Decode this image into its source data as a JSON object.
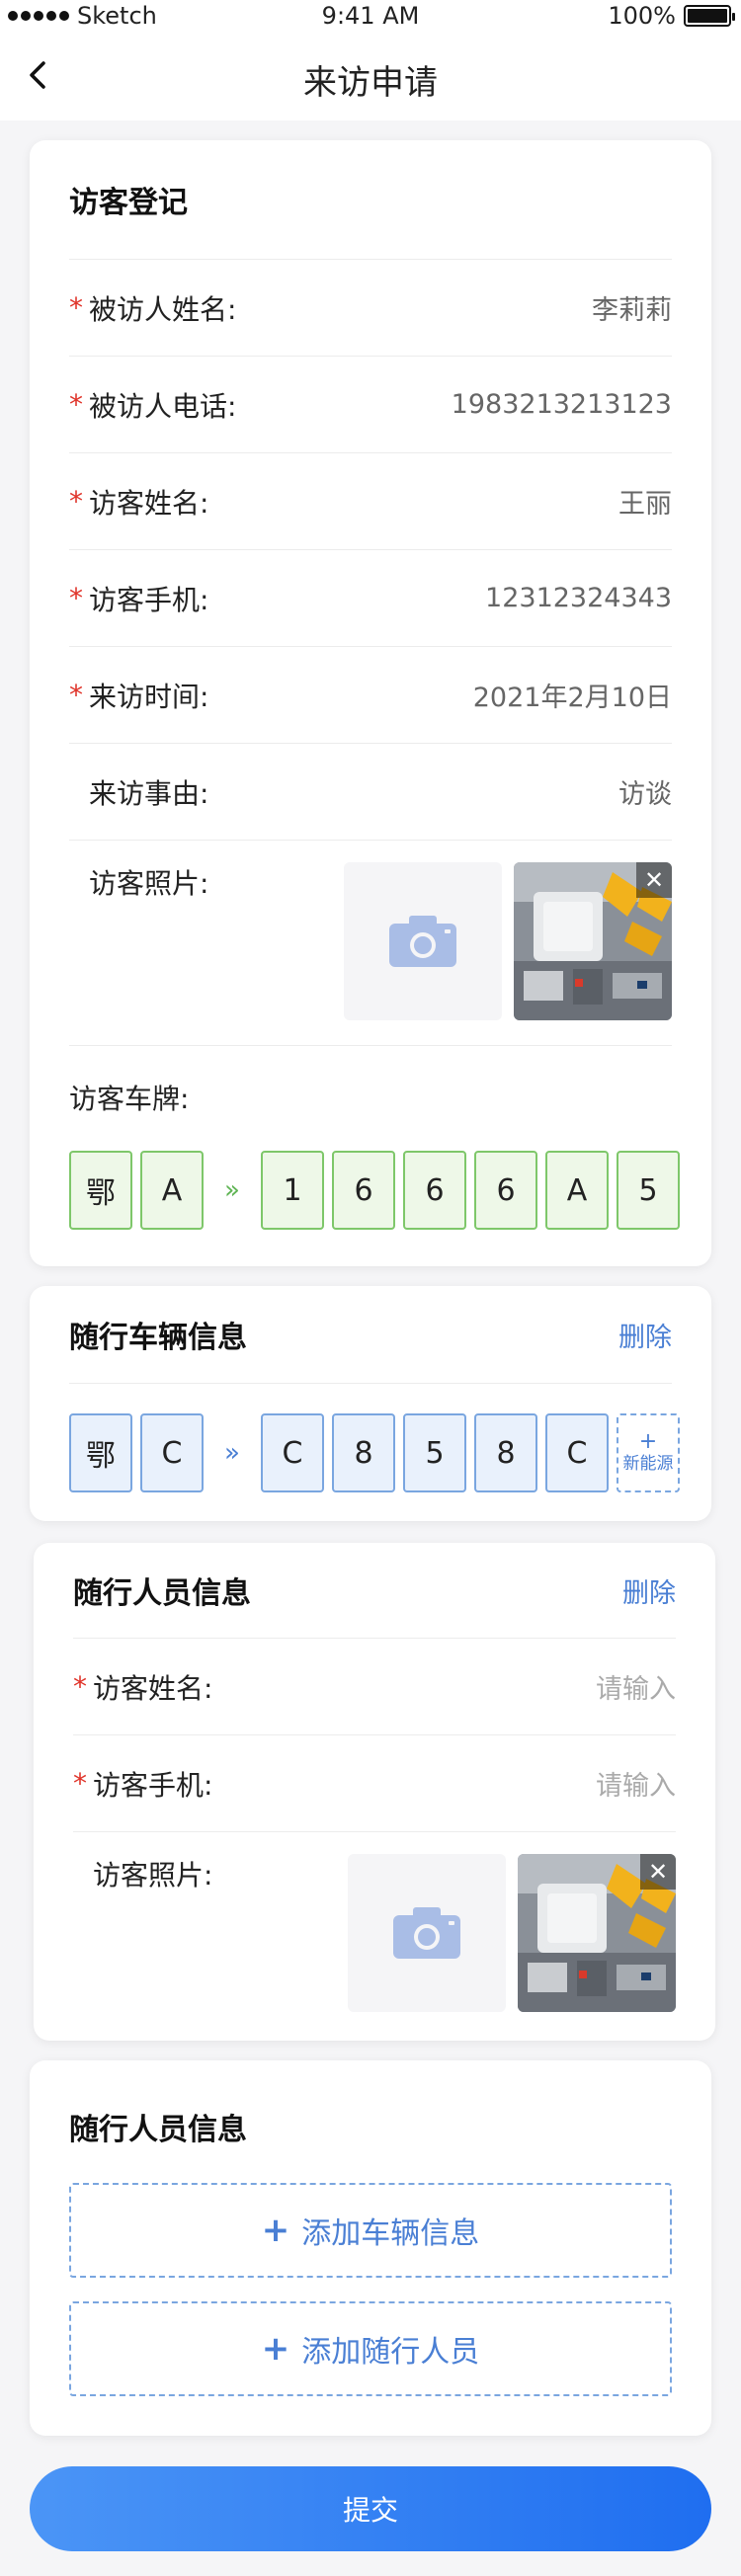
{
  "status_bar": {
    "carrier": "Sketch",
    "time": "9:41 AM",
    "battery": "100%"
  },
  "nav": {
    "title": "来访申请",
    "back_icon": "chevron-left-icon"
  },
  "visitor_card": {
    "title": "访客登记",
    "fields": [
      {
        "label": "被访人姓名:",
        "value": "李莉莉",
        "required": true
      },
      {
        "label": "被访人电话:",
        "value": "1983213213123",
        "required": true
      },
      {
        "label": "访客姓名:",
        "value": "王丽",
        "required": true
      },
      {
        "label": "访客手机:",
        "value": "12312324343",
        "required": true
      },
      {
        "label": "来访时间:",
        "value": "2021年2月10日",
        "required": true
      },
      {
        "label": "来访事由:",
        "value": "访谈",
        "required": false
      }
    ],
    "photo_label": "访客照片:",
    "plate_label": "访客车牌:",
    "plate": {
      "province": "鄂",
      "letter": "A",
      "separator": "»",
      "chars": [
        "1",
        "6",
        "6",
        "6",
        "A",
        "5"
      ]
    }
  },
  "vehicle_card": {
    "title": "随行车辆信息",
    "delete_label": "删除",
    "plate": {
      "province": "鄂",
      "letter": "C",
      "separator": "»",
      "chars": [
        "C",
        "8",
        "5",
        "8",
        "C"
      ]
    },
    "new_energy": {
      "plus": "+",
      "label": "新能源"
    }
  },
  "companion_card": {
    "title": "随行人员信息",
    "delete_label": "删除",
    "fields": [
      {
        "label": "访客姓名:",
        "placeholder": "请输入",
        "required": true
      },
      {
        "label": "访客手机:",
        "placeholder": "请输入",
        "required": true
      }
    ],
    "photo_label": "访客照片:"
  },
  "add_card": {
    "title": "随行人员信息",
    "add_vehicle": "添加车辆信息",
    "add_person": "添加随行人员",
    "plus": "+"
  },
  "required_mark": "*",
  "close_mark": "✕",
  "submit_label": "提交",
  "colors": {
    "primary": "#1f6ef0",
    "link": "#4a7fd4",
    "required": "#e0342a",
    "plate_green": "#7ec76a",
    "plate_blue": "#7aa6e0"
  }
}
